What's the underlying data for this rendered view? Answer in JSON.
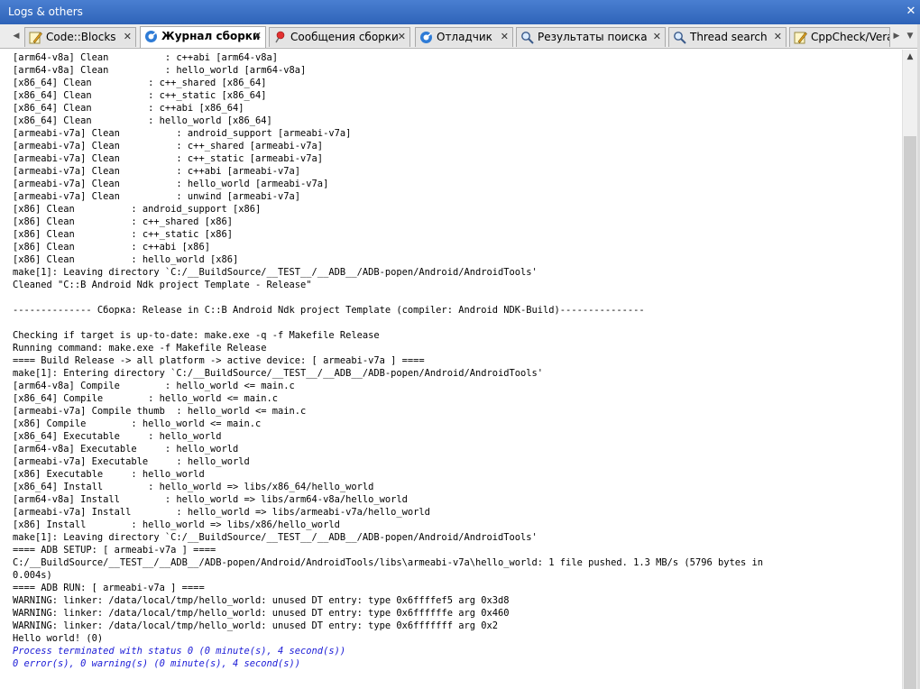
{
  "window": {
    "title": "Logs & others",
    "close_glyph": "✕"
  },
  "tabs": [
    {
      "label": "Code::Blocks",
      "icon": "pencil-note-icon",
      "close": "✕",
      "active": false
    },
    {
      "label": "Журнал сборки",
      "icon": "gear-build-icon",
      "close": "✕",
      "active": true
    },
    {
      "label": "Сообщения сборки",
      "icon": "pin-icon",
      "close": "✕",
      "active": false
    },
    {
      "label": "Отладчик",
      "icon": "gear-debug-icon",
      "close": "✕",
      "active": false
    },
    {
      "label": "Результаты поиска",
      "icon": "magnifier-icon",
      "close": "✕",
      "active": false
    },
    {
      "label": "Thread search",
      "icon": "magnifier-icon",
      "close": "✕",
      "active": false
    },
    {
      "label": "CppCheck/Vera++",
      "icon": "pencil-note-icon",
      "close": "",
      "active": false
    }
  ],
  "nav": {
    "left": "◀",
    "right_play": "▶",
    "right_down": "▼"
  },
  "scroll": {
    "up": "▲"
  },
  "log": {
    "lines": [
      "[arm64-v8a] Clean          : c++abi [arm64-v8a]",
      "[arm64-v8a] Clean          : hello_world [arm64-v8a]",
      "[x86_64] Clean          : c++_shared [x86_64]",
      "[x86_64] Clean          : c++_static [x86_64]",
      "[x86_64] Clean          : c++abi [x86_64]",
      "[x86_64] Clean          : hello_world [x86_64]",
      "[armeabi-v7a] Clean          : android_support [armeabi-v7a]",
      "[armeabi-v7a] Clean          : c++_shared [armeabi-v7a]",
      "[armeabi-v7a] Clean          : c++_static [armeabi-v7a]",
      "[armeabi-v7a] Clean          : c++abi [armeabi-v7a]",
      "[armeabi-v7a] Clean          : hello_world [armeabi-v7a]",
      "[armeabi-v7a] Clean          : unwind [armeabi-v7a]",
      "[x86] Clean          : android_support [x86]",
      "[x86] Clean          : c++_shared [x86]",
      "[x86] Clean          : c++_static [x86]",
      "[x86] Clean          : c++abi [x86]",
      "[x86] Clean          : hello_world [x86]",
      "make[1]: Leaving directory `C:/__BuildSource/__TEST__/__ADB__/ADB-popen/Android/AndroidTools'",
      "Cleaned \"C::B Android Ndk project Template - Release\"",
      "",
      "-------------- Сборка: Release in C::B Android Ndk project Template (compiler: Android NDK-Build)---------------",
      "",
      "Checking if target is up-to-date: make.exe -q -f Makefile Release",
      "Running command: make.exe -f Makefile Release",
      "==== Build Release -> all platform -> active device: [ armeabi-v7a ] ====",
      "make[1]: Entering directory `C:/__BuildSource/__TEST__/__ADB__/ADB-popen/Android/AndroidTools'",
      "[arm64-v8a] Compile        : hello_world <= main.c",
      "[x86_64] Compile        : hello_world <= main.c",
      "[armeabi-v7a] Compile thumb  : hello_world <= main.c",
      "[x86] Compile        : hello_world <= main.c",
      "[x86_64] Executable     : hello_world",
      "[arm64-v8a] Executable     : hello_world",
      "[armeabi-v7a] Executable     : hello_world",
      "[x86] Executable     : hello_world",
      "[x86_64] Install        : hello_world => libs/x86_64/hello_world",
      "[arm64-v8a] Install        : hello_world => libs/arm64-v8a/hello_world",
      "[armeabi-v7a] Install        : hello_world => libs/armeabi-v7a/hello_world",
      "[x86] Install        : hello_world => libs/x86/hello_world",
      "make[1]: Leaving directory `C:/__BuildSource/__TEST__/__ADB__/ADB-popen/Android/AndroidTools'",
      "==== ADB SETUP: [ armeabi-v7a ] ====",
      "C:/__BuildSource/__TEST__/__ADB__/ADB-popen/Android/AndroidTools/libs\\armeabi-v7a\\hello_world: 1 file pushed. 1.3 MB/s (5796 bytes in",
      "0.004s)",
      "==== ADB RUN: [ armeabi-v7a ] ====",
      "WARNING: linker: /data/local/tmp/hello_world: unused DT entry: type 0x6ffffef5 arg 0x3d8",
      "WARNING: linker: /data/local/tmp/hello_world: unused DT entry: type 0x6ffffffe arg 0x460",
      "WARNING: linker: /data/local/tmp/hello_world: unused DT entry: type 0x6fffffff arg 0x2",
      "Hello world! (0)"
    ],
    "status_lines": [
      "Process terminated with status 0 (0 minute(s), 4 second(s))",
      "0 error(s), 0 warning(s) (0 minute(s), 4 second(s))"
    ],
    "status_color": "#1a1ad6"
  }
}
